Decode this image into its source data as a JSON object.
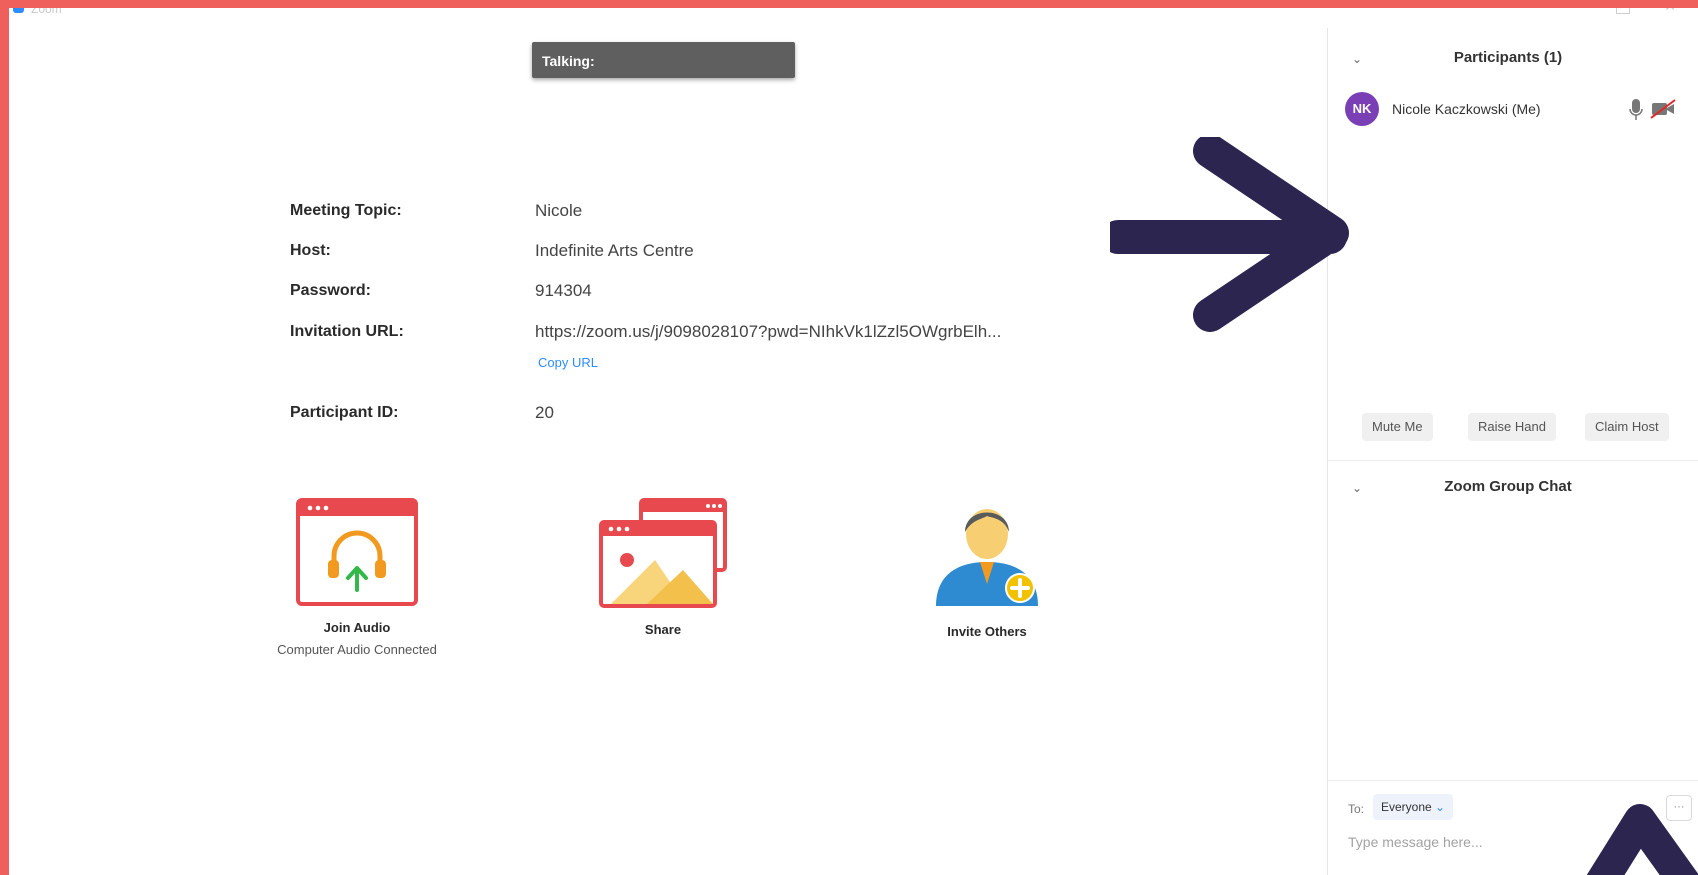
{
  "window": {
    "app_title": "Zoom"
  },
  "talking": {
    "label": "Talking:"
  },
  "meeting_info": {
    "topic_label": "Meeting Topic:",
    "topic_value": "Nicole",
    "host_label": "Host:",
    "host_value": "Indefinite Arts Centre",
    "password_label": "Password:",
    "password_value": "914304",
    "url_label": "Invitation URL:",
    "url_value": "https://zoom.us/j/9098028107?pwd=NIhkVk1lZzl5OWgrbElh...",
    "copy_url_label": "Copy URL",
    "participant_id_label": "Participant ID:",
    "participant_id_value": "20"
  },
  "actions": {
    "join_audio": {
      "label": "Join Audio",
      "sub": "Computer Audio Connected"
    },
    "share": {
      "label": "Share"
    },
    "invite": {
      "label": "Invite Others"
    }
  },
  "participants_panel": {
    "title": "Participants (1)",
    "participant": {
      "initials": "NK",
      "name": "Nicole Kaczkowski (Me)",
      "avatar_color": "#7b3fb5"
    },
    "buttons": {
      "mute": "Mute Me",
      "raise_hand": "Raise Hand",
      "claim_host": "Claim Host"
    }
  },
  "chat_panel": {
    "title": "Zoom Group Chat",
    "to_label": "To:",
    "recipient": "Everyone",
    "more_label": "···",
    "placeholder": "Type message here..."
  },
  "colors": {
    "background": "#ef5f5c",
    "accent": "#2d8cff",
    "annotation_arrow": "#2b2550"
  }
}
